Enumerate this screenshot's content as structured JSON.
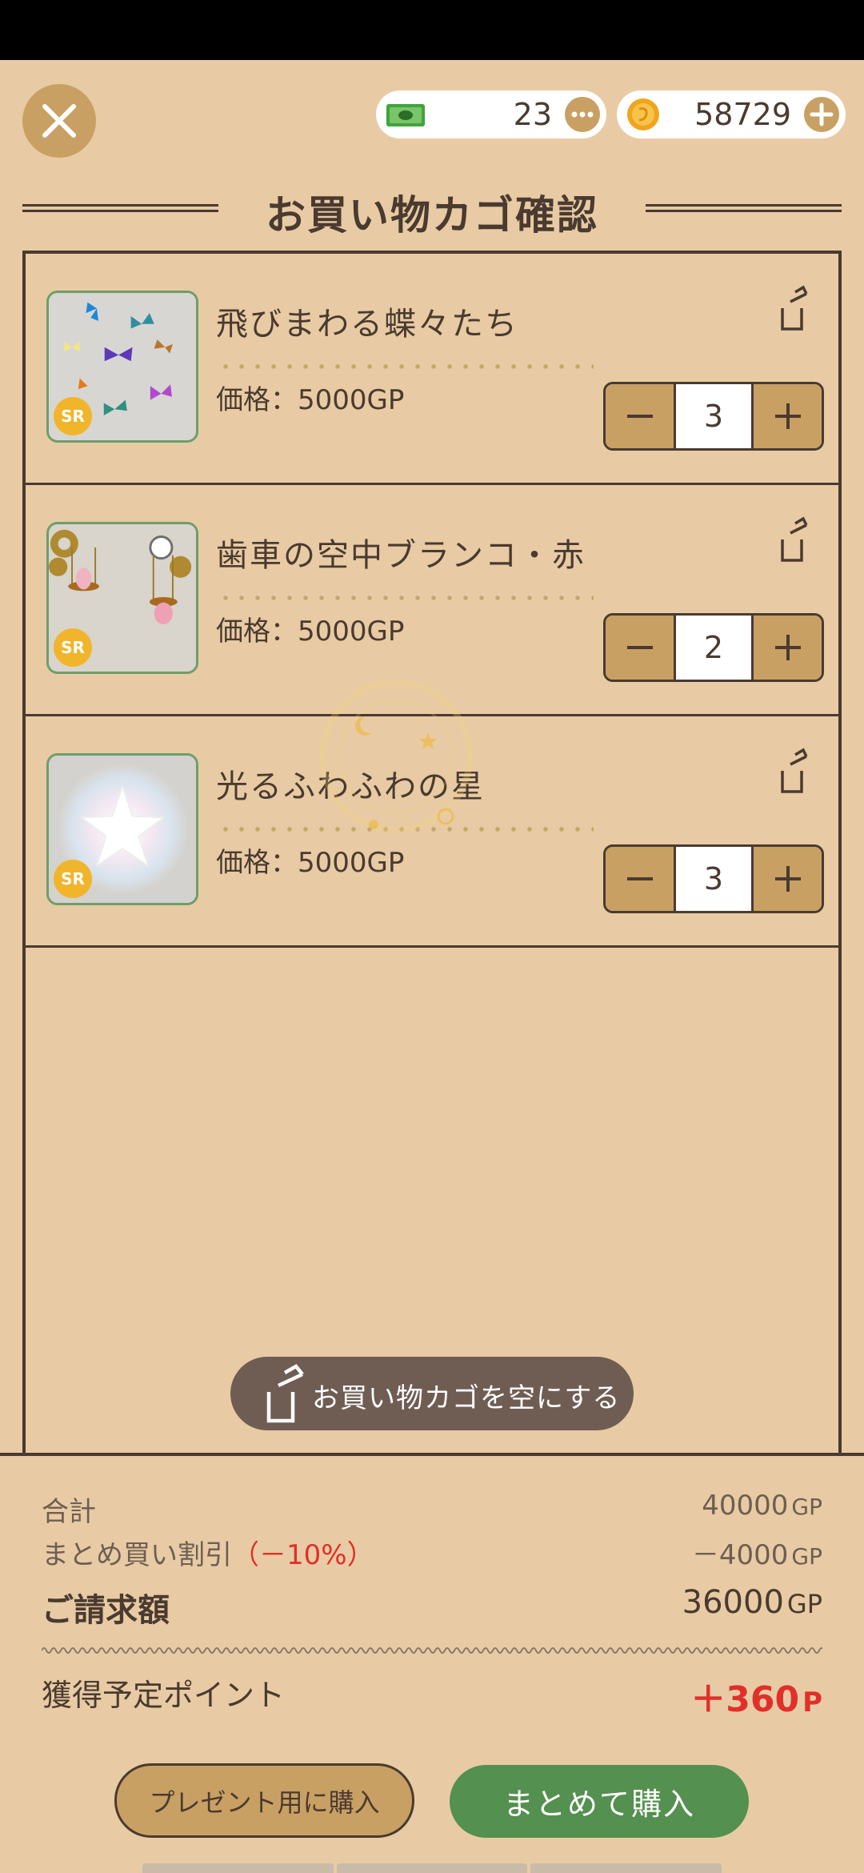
{
  "header": {
    "title": "お買い物カゴ確認",
    "tickets": "23",
    "coins": "58729"
  },
  "items": [
    {
      "name": "飛びまわる蝶々たち",
      "price": "価格：5000GP",
      "qty": "3",
      "rarity": "SR"
    },
    {
      "name": "歯車の空中ブランコ・赤",
      "price": "価格：5000GP",
      "qty": "2",
      "rarity": "SR"
    },
    {
      "name": "光るふわふわの星",
      "price": "価格：5000GP",
      "qty": "3",
      "rarity": "SR"
    }
  ],
  "empty_cart_label": "お買い物カゴを空にする",
  "summary": {
    "total_label": "合計",
    "total_value": "40000",
    "discount_label": "まとめ買い割引",
    "discount_rate": "（－10%）",
    "discount_value": "－4000",
    "bill_label": "ご請求額",
    "bill_value": "36000",
    "unit": "GP",
    "points_label": "獲得予定ポイント",
    "points_value": "＋360",
    "points_unit": "P"
  },
  "buttons": {
    "gift": "プレゼント用に購入",
    "buy": "まとめて購入"
  },
  "colors": {
    "background": "#e8cba4",
    "accent_gold": "#c9a063",
    "buy_green": "#54904f",
    "text_dark": "#4a3a30",
    "discount_red": "#e0302b"
  }
}
